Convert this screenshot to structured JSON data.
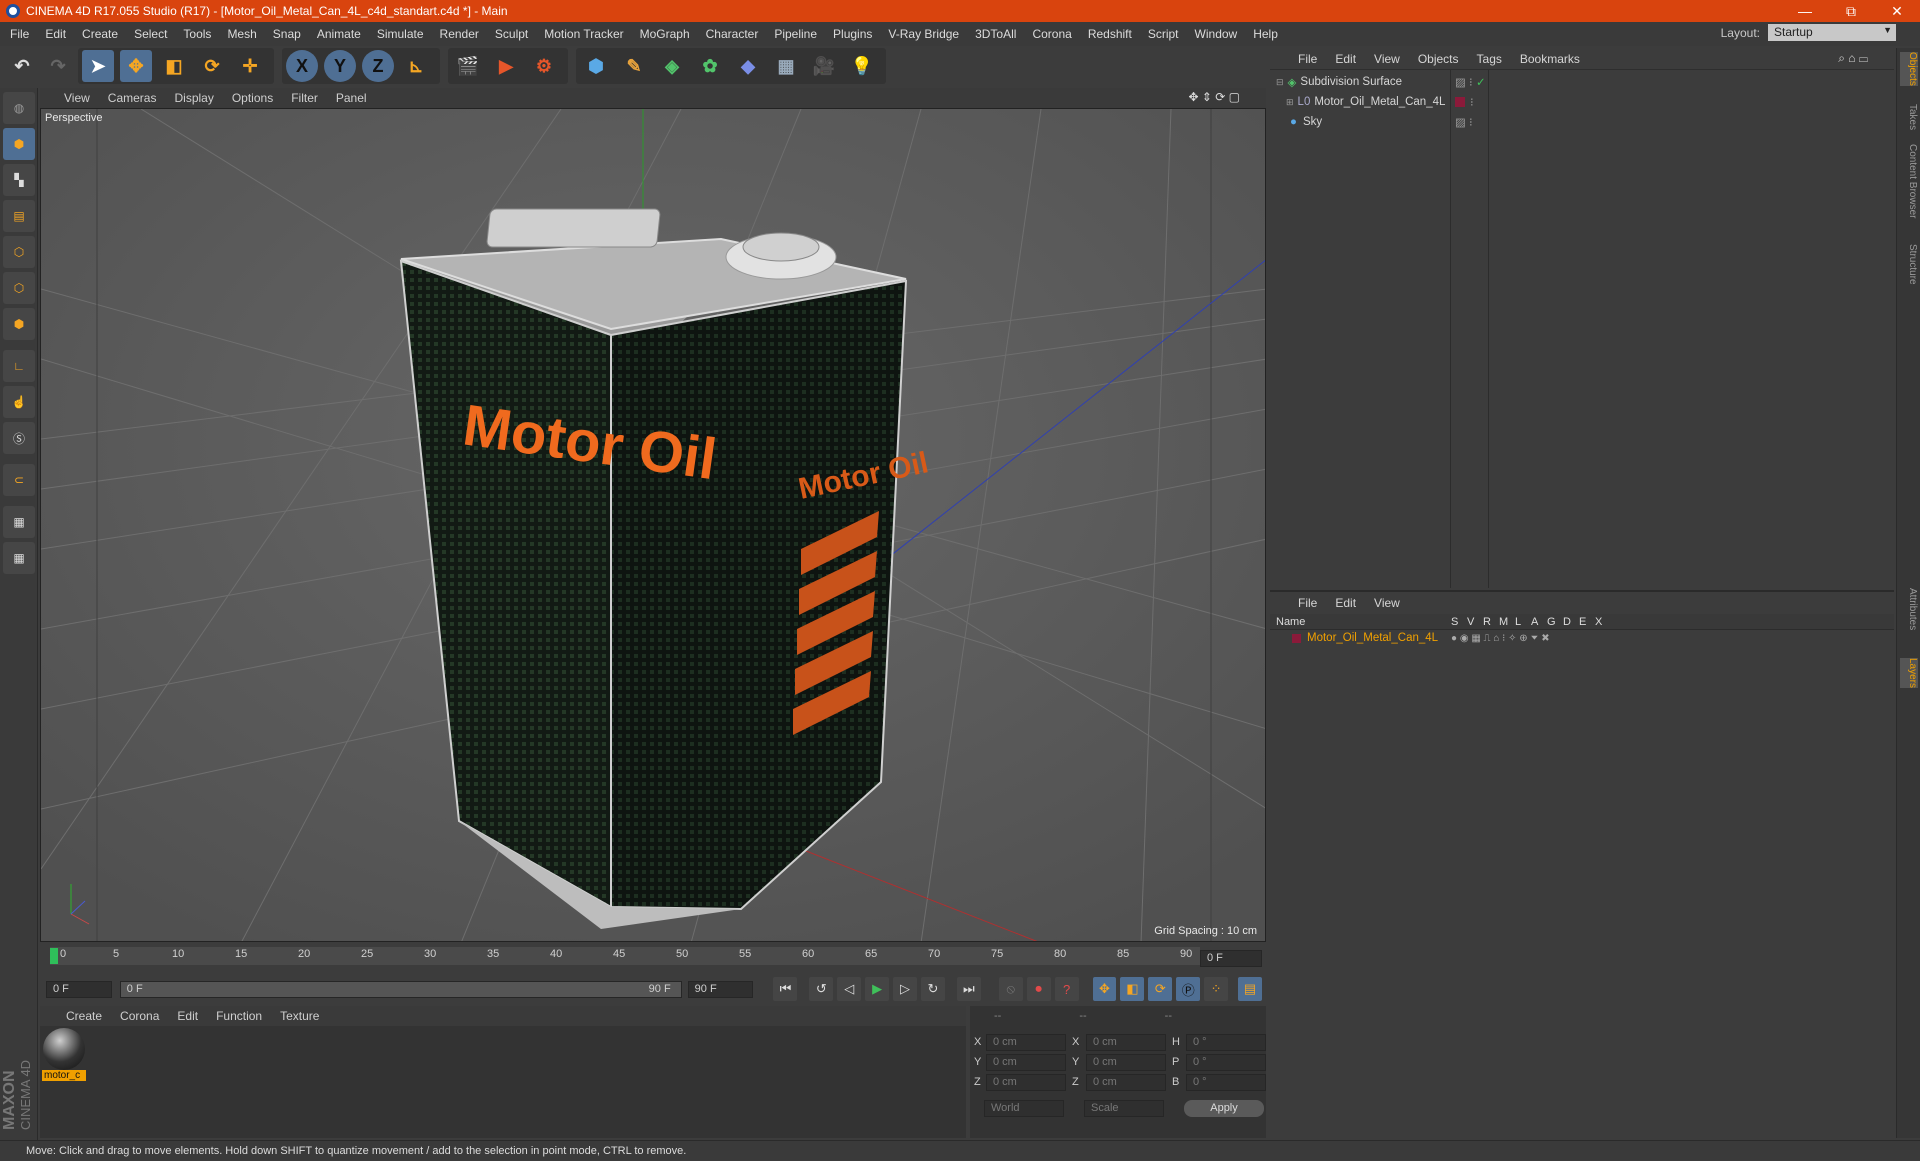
{
  "window": {
    "title": "CINEMA 4D R17.055 Studio (R17) - [Motor_Oil_Metal_Can_4L_c4d_standart.c4d *] - Main",
    "min": "—",
    "restore": "⧉",
    "close": "✕"
  },
  "menu": [
    "File",
    "Edit",
    "Create",
    "Select",
    "Tools",
    "Mesh",
    "Snap",
    "Animate",
    "Simulate",
    "Render",
    "Sculpt",
    "Motion Tracker",
    "MoGraph",
    "Character",
    "Pipeline",
    "Plugins",
    "V-Ray Bridge",
    "3DToAll",
    "Corona",
    "Redshift",
    "Script",
    "Window",
    "Help"
  ],
  "layout": {
    "label": "Layout:",
    "value": "Startup"
  },
  "toolbar": {
    "x": "X",
    "y": "Y",
    "z": "Z"
  },
  "viewport": {
    "menu": [
      "View",
      "Cameras",
      "Display",
      "Options",
      "Filter",
      "Panel"
    ],
    "label": "Perspective",
    "grid_spacing": "Grid Spacing : 10 cm",
    "can_text": "Motor Oil",
    "can_side_text": "Motor Oil"
  },
  "timeline": {
    "ticks": [
      "0",
      "5",
      "10",
      "15",
      "20",
      "25",
      "30",
      "35",
      "40",
      "45",
      "50",
      "55",
      "60",
      "65",
      "70",
      "75",
      "80",
      "85",
      "90"
    ],
    "end_field": "0 F"
  },
  "transport": {
    "start": "0 F",
    "slider_left": "0 F",
    "slider_right": "90 F",
    "end": "90 F"
  },
  "materials": {
    "menu": [
      "Create",
      "Corona",
      "Edit",
      "Function",
      "Texture"
    ],
    "item": "motor_c"
  },
  "coords": {
    "header": [
      "--",
      "--",
      "--"
    ],
    "rows": [
      [
        "X",
        "0 cm",
        "X",
        "0 cm",
        "H",
        "0 °"
      ],
      [
        "Y",
        "0 cm",
        "Y",
        "0 cm",
        "P",
        "0 °"
      ],
      [
        "Z",
        "0 cm",
        "Z",
        "0 cm",
        "B",
        "0 °"
      ]
    ],
    "world": "World",
    "scale": "Scale",
    "apply": "Apply"
  },
  "objects": {
    "menu": [
      "File",
      "Edit",
      "View",
      "Objects",
      "Tags",
      "Bookmarks"
    ],
    "items": [
      "Subdivision Surface",
      "Motor_Oil_Metal_Can_4L",
      "Sky"
    ]
  },
  "layers": {
    "menu": [
      "File",
      "Edit",
      "View"
    ],
    "name_header": "Name",
    "cols": [
      "S",
      "V",
      "R",
      "M",
      "L",
      "A",
      "G",
      "D",
      "E",
      "X"
    ],
    "item": "Motor_Oil_Metal_Can_4L"
  },
  "side_tabs": [
    "Objects",
    "Takes",
    "Content Browser",
    "Structure",
    "Attributes",
    "Layers"
  ],
  "brand": {
    "maxon": "MAXON",
    "c4d": "CINEMA 4D"
  },
  "status": "Move: Click and drag to move elements. Hold down SHIFT to quantize movement / add to the selection in point mode, CTRL to remove.",
  "colors": {
    "accent": "#d9440e",
    "selected": "#f0a000",
    "active_tool": "#4a90d9"
  }
}
